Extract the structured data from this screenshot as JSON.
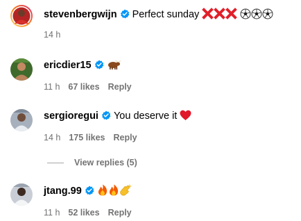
{
  "caption": {
    "username": "stevenbergwijn",
    "text": "Perfect sunday",
    "emojis": [
      "cross-mark-icon",
      "cross-mark-icon",
      "cross-mark-icon",
      "soccer-ball-icon",
      "soccer-ball-icon",
      "soccer-ball-icon"
    ],
    "time": "14 h"
  },
  "comments": [
    {
      "username": "ericdier15",
      "text": "",
      "emojis": [
        "ox-icon"
      ],
      "time": "11 h",
      "likes": "67 likes",
      "reply_label": "Reply"
    },
    {
      "username": "sergioregui",
      "text": "You deserve it",
      "emojis": [
        "red-heart-icon"
      ],
      "time": "14 h",
      "likes": "175 likes",
      "reply_label": "Reply"
    },
    {
      "username": "jtang.99",
      "text": "",
      "emojis": [
        "fire-icon",
        "fire-icon",
        "clapping-hands-icon"
      ],
      "time": "11 h",
      "likes": "52 likes",
      "reply_label": "Reply"
    }
  ],
  "view_replies_label": "View replies (5)",
  "colors": {
    "verified_badge": "#0095f6",
    "meta_text": "#737373",
    "story_ring_start": "#feda75",
    "story_ring_end": "#d62976"
  }
}
